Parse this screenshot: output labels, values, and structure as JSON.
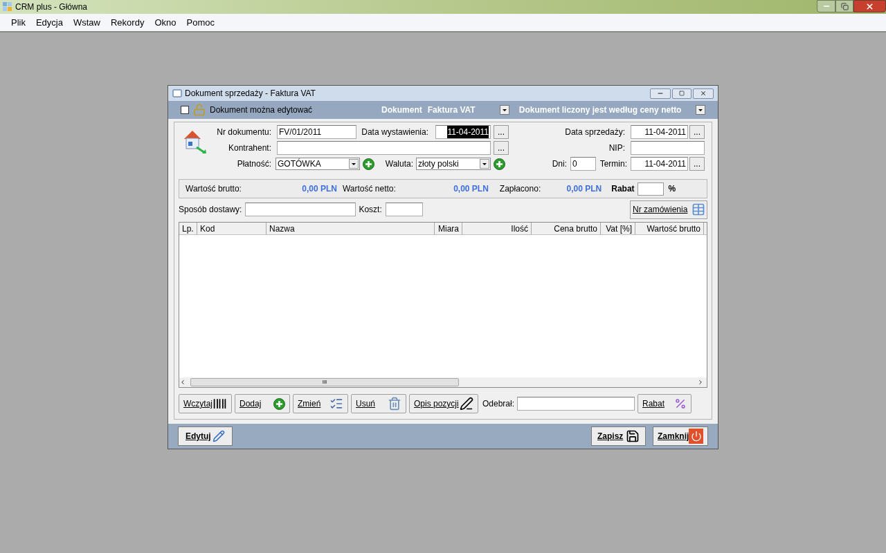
{
  "app": {
    "title": "CRM plus - Główna",
    "menu": [
      "Plik",
      "Edycja",
      "Wstaw",
      "Rekordy",
      "Okno",
      "Pomoc"
    ]
  },
  "dialog": {
    "title": "Dokument sprzedaży - Faktura VAT",
    "header": {
      "editable": {
        "label": "Dokument można edytować",
        "checked": false
      },
      "document_label": "Dokument",
      "document_type": "Faktura VAT",
      "pricing_mode": "Dokument liczony jest według ceny netto"
    },
    "form": {
      "nr_dokumentu": {
        "label": "Nr dokumentu:",
        "value": "FV/01/2011"
      },
      "data_wystawienia": {
        "label": "Data wystawienia:",
        "value": "11-04-2011",
        "highlighted": true
      },
      "data_sprzedazy": {
        "label": "Data sprzedaży:",
        "value": "11-04-2011"
      },
      "kontrahent": {
        "label": "Kontrahent:"
      },
      "nip": {
        "label": "NIP:"
      },
      "platnosc": {
        "label": "Płatność:",
        "value": "GOTÓWKA"
      },
      "waluta": {
        "label": "Waluta:",
        "value": "złoty polski"
      },
      "dni": {
        "label": "Dni:",
        "value": "0"
      },
      "termin": {
        "label": "Termin:",
        "value": "11-04-2011"
      },
      "browse_button": "..."
    },
    "summary": {
      "brutto_label": "Wartość brutto:",
      "brutto": "0,00 PLN",
      "netto_label": "Wartość netto:",
      "netto": "0,00 PLN",
      "paid_label": "Zapłacono:",
      "paid": "0,00 PLN",
      "rabat_label": "Rabat",
      "percent": "%"
    },
    "delivery": {
      "label": "Sposób dostawy:",
      "cost_label": "Koszt:",
      "order_button": "Nr zamówienia"
    },
    "table": {
      "columns": [
        "Lp.",
        "Kod",
        "Nazwa",
        "Miara",
        "Ilość",
        "Cena brutto",
        "Vat [%]",
        "Wartość brutto"
      ],
      "scroll_grip": "III"
    },
    "actions": {
      "load": "Wczytaj",
      "add": "Dodaj",
      "change": "Zmień",
      "remove": "Usuń",
      "description": "Opis pozycji",
      "received_label": "Odebrał:",
      "rabat": "Rabat"
    },
    "footer": {
      "edit": "Edytuj",
      "save": "Zapisz",
      "close": "Zamknij"
    }
  }
}
